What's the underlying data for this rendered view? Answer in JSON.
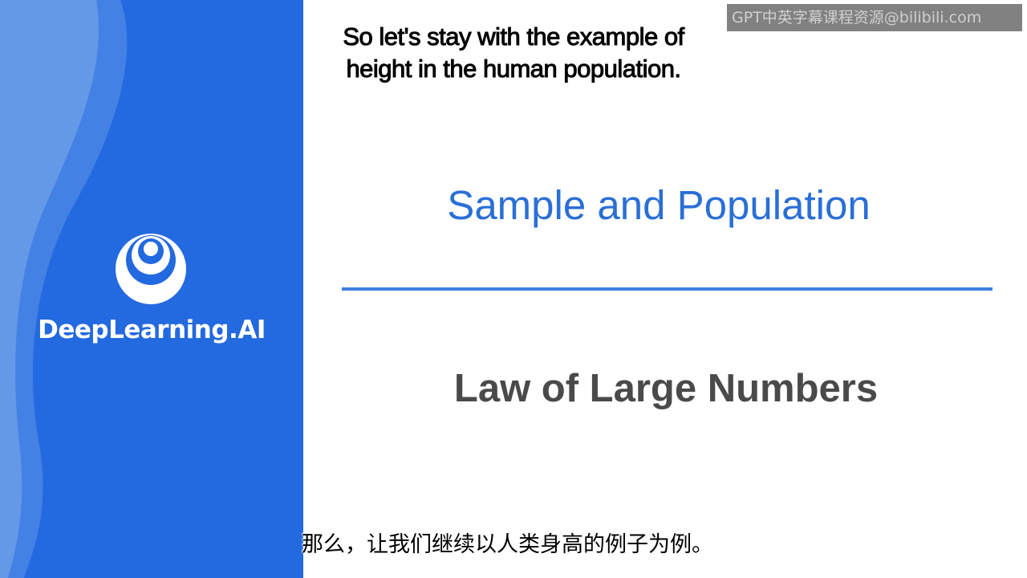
{
  "brand": {
    "name": "DeepLearning.AI",
    "accent_color": "#2369e0",
    "logo_icon": "concentric-circles-logo-icon"
  },
  "watermark": {
    "text": "GPT中英字幕课程资源@bilibili.com"
  },
  "subtitles": {
    "english_line1": "So let's stay with the example of",
    "english_line2": "height in the human population.",
    "chinese": "那么，让我们继续以人类身高的例子为例。"
  },
  "slide": {
    "title": "Sample and Population",
    "title_color": "#2a6fd6",
    "subtitle": "Law of Large Numbers",
    "subtitle_color": "#4a4a4a"
  }
}
